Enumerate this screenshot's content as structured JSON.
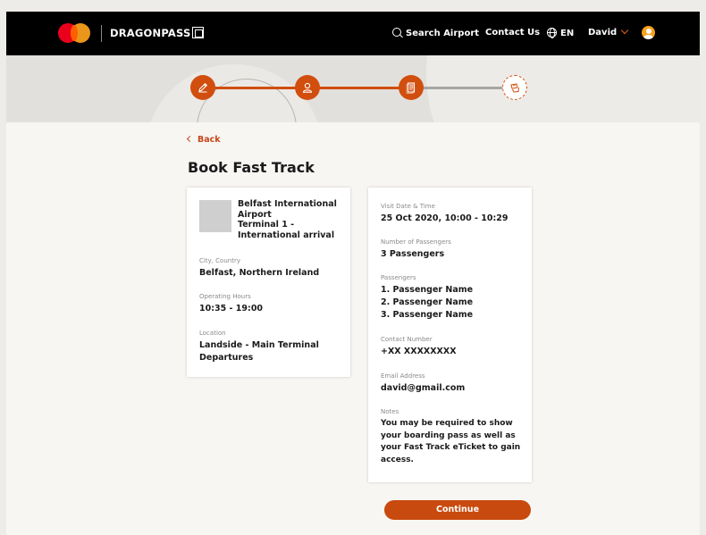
{
  "header": {
    "brand": "DRAGONPASS",
    "search_label": "Search Airport",
    "contact_label": "Contact Us",
    "language": "EN",
    "user_name": "David"
  },
  "stepper": {
    "current_step": 4,
    "total_steps": 4,
    "steps": [
      {
        "icon": "pencil-icon",
        "state": "done"
      },
      {
        "icon": "user-icon",
        "state": "done"
      },
      {
        "icon": "document-icon",
        "state": "done"
      },
      {
        "icon": "ticket-hand-icon",
        "state": "current"
      }
    ]
  },
  "back_label": "Back",
  "page_title": "Book Fast Track",
  "airport": {
    "name_lines": [
      "Belfast International",
      "Airport",
      "Terminal 1 -",
      "International arrival"
    ],
    "city_label": "City, Country",
    "city_value": "Belfast, Northern Ireland",
    "hours_label": "Operating Hours",
    "hours_value": "10:35 - 19:00",
    "location_label": "Location",
    "location_lines": [
      "Landside - Main Terminal",
      "Departures"
    ]
  },
  "booking": {
    "visit_label": "Visit Date & Time",
    "visit_value": "25 Oct 2020, 10:00 - 10:29",
    "num_label": "Number of Passengers",
    "num_value": "3 Passengers",
    "passengers_label": "Passengers",
    "passengers": [
      "1. Passenger Name",
      "2. Passenger Name",
      "3. Passenger Name"
    ],
    "contact_label": "Contact Number",
    "contact_value": "+XX XXXXXXXX",
    "email_label": "Email Address",
    "email_value": "david@gmail.com",
    "notes_label": "Notes",
    "notes_lines": [
      "You may be required to show",
      "your boarding pass as well as",
      "your Fast Track eTicket to gain",
      "access."
    ]
  },
  "continue_label": "Continue",
  "colors": {
    "accent": "#d14e0e",
    "header_bg": "#000000",
    "page_bg": "#f7f6f3"
  }
}
